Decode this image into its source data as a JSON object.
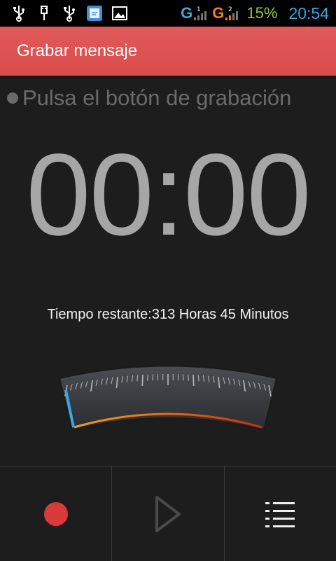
{
  "status_bar": {
    "icons": [
      "usb-icon",
      "usb-icon",
      "usb-icon",
      "file-icon",
      "gallery-icon"
    ],
    "sim1_label": "G",
    "sim1_slot": "1",
    "sim2_label": "G",
    "sim2_slot": "2",
    "battery": "15%",
    "time": "20:54",
    "colors": {
      "sim1": "#3aa7e0",
      "sim2": "#f47b20",
      "battery": "#8ec63f",
      "time": "#3aa7e0"
    }
  },
  "header": {
    "title": "Grabar mensaje",
    "color": "#e05555"
  },
  "main": {
    "hint": "Pulsa el botón de grabación",
    "timer": "00:00",
    "remaining_label": "Tiempo restante:",
    "remaining_value": "313 Horas 45 Minutos",
    "meter_level": 0
  },
  "bottom_bar": {
    "buttons": [
      {
        "name": "record",
        "icon": "record-icon",
        "color": "#d83a3a"
      },
      {
        "name": "play",
        "icon": "play-icon",
        "enabled": false
      },
      {
        "name": "list",
        "icon": "list-icon"
      }
    ]
  }
}
